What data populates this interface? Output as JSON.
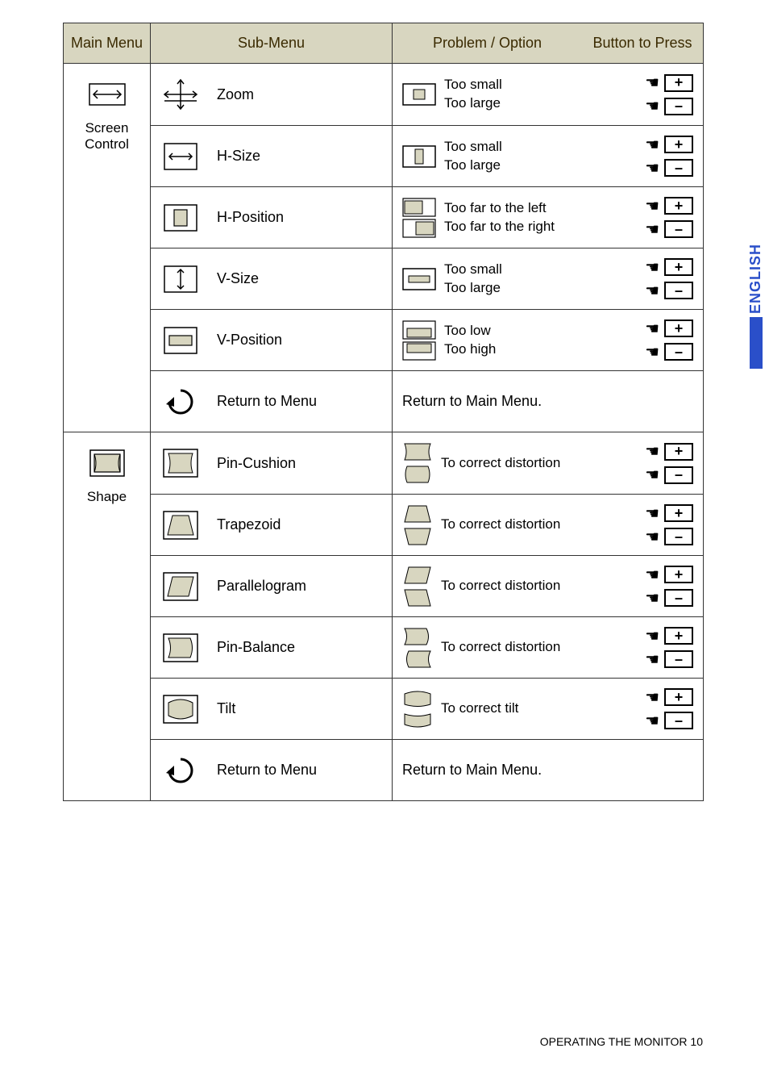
{
  "header": {
    "mainMenu": "Main Menu",
    "subMenu": "Sub-Menu",
    "problem": "Problem / Option",
    "button": "Button to Press"
  },
  "sideTab": "ENGLISH",
  "footer": "OPERATING THE MONITOR   10",
  "buttons": {
    "plus": "+",
    "minus": "–"
  },
  "screenControl": {
    "label": "Screen\nControl",
    "rows": [
      {
        "sub": "Zoom",
        "p1": "Too small",
        "p2": "Too large"
      },
      {
        "sub": "H-Size",
        "p1": "Too small",
        "p2": "Too large"
      },
      {
        "sub": "H-Position",
        "p1": "Too far to the left",
        "p2": "Too far to the right"
      },
      {
        "sub": "V-Size",
        "p1": "Too small",
        "p2": "Too large"
      },
      {
        "sub": "V-Position",
        "p1": "Too low",
        "p2": "Too high"
      },
      {
        "sub": "Return to Menu",
        "right": "Return to Main Menu."
      }
    ]
  },
  "shape": {
    "label": "Shape",
    "rows": [
      {
        "sub": "Pin-Cushion",
        "right": "To  correct  distortion"
      },
      {
        "sub": "Trapezoid",
        "right": "To  correct  distortion"
      },
      {
        "sub": "Parallelogram",
        "right": "To  correct  distortion"
      },
      {
        "sub": "Pin-Balance",
        "right": "To  correct  distortion"
      },
      {
        "sub": "Tilt",
        "right": "To  correct  tilt"
      },
      {
        "sub": "Return to Menu",
        "right": "Return to Main Menu."
      }
    ]
  }
}
